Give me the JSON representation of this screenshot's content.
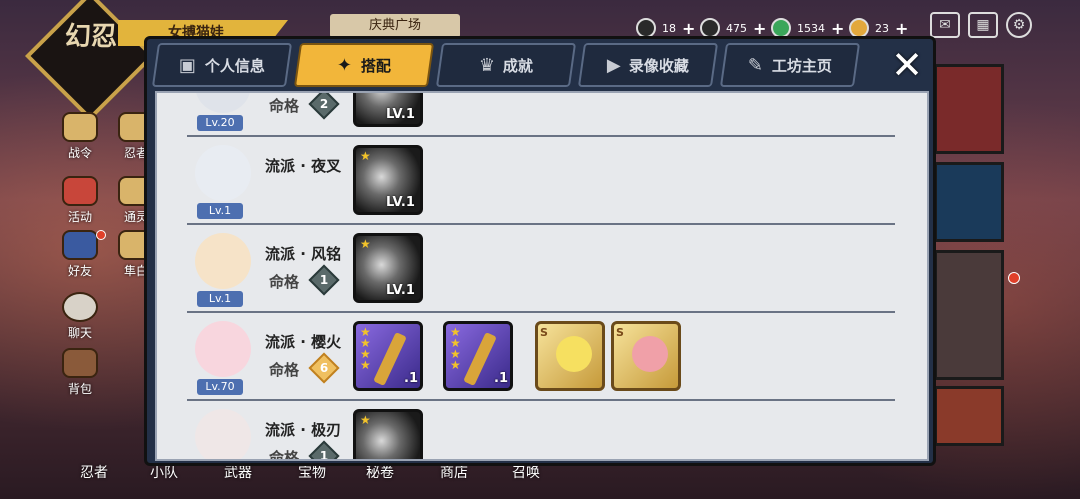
{
  "hud": {
    "logo_text": "幻忍",
    "player_name": "女搏猫娃",
    "plaza": "庆典广场",
    "resources": [
      {
        "icon": "onigiri-icon",
        "value": "18"
      },
      {
        "icon": "coin-icon",
        "value": "475"
      },
      {
        "icon": "jade-icon",
        "value": "1534"
      },
      {
        "icon": "token-icon",
        "value": "23"
      }
    ],
    "icons": [
      "mail-icon",
      "shop-icon",
      "gear-icon"
    ]
  },
  "sidebar": [
    {
      "label": "战令",
      "icon": "battle-pass-icon"
    },
    {
      "label": "忍者",
      "icon": "ninja-icon"
    },
    {
      "label": "活动",
      "icon": "torii-icon"
    },
    {
      "label": "通灵",
      "icon": "summon-spirit-icon"
    },
    {
      "label": "好友",
      "icon": "friend-icon"
    },
    {
      "label": "隼白",
      "icon": "falcon-icon"
    },
    {
      "label": "聊天",
      "icon": "chat-icon"
    },
    {
      "label": "背包",
      "icon": "bag-icon"
    }
  ],
  "bottom_nav": [
    "忍者",
    "小队",
    "武器",
    "宝物",
    "秘卷",
    "商店",
    "召唤"
  ],
  "modal": {
    "tabs": [
      {
        "label": "个人信息",
        "icon": "profile-icon",
        "active": false
      },
      {
        "label": "搭配",
        "icon": "shuriken-icon",
        "active": true
      },
      {
        "label": "成就",
        "icon": "trophy-icon",
        "active": false
      },
      {
        "label": "录像收藏",
        "icon": "play-icon",
        "active": false
      },
      {
        "label": "工坊主页",
        "icon": "pen-icon",
        "active": false
      }
    ],
    "close": "✕",
    "fate_label": "命格",
    "rows": [
      {
        "level": "Lv.20",
        "school": "",
        "fate": "2",
        "items": [
          {
            "type": "weapon",
            "stars": 1,
            "lv": "LV.1"
          }
        ]
      },
      {
        "level": "Lv.1",
        "school": "流派 · 夜叉",
        "fate": "",
        "items": [
          {
            "type": "weapon",
            "stars": 1,
            "lv": "LV.1"
          }
        ]
      },
      {
        "level": "Lv.1",
        "school": "流派 · 风铭",
        "fate": "1",
        "items": [
          {
            "type": "weapon",
            "stars": 1,
            "lv": "LV.1"
          }
        ]
      },
      {
        "level": "Lv.70",
        "school": "流派 · 樱火",
        "fate": "6",
        "items": [
          {
            "type": "purple",
            "stars": 4,
            "lv": ".1"
          },
          {
            "type": "purple",
            "stars": 4,
            "lv": ".1"
          },
          {
            "type": "gold",
            "badge": "S"
          },
          {
            "type": "gold",
            "badge": "S"
          }
        ]
      },
      {
        "level": "",
        "school": "流派 · 极刃",
        "fate": "1",
        "items": [
          {
            "type": "weapon",
            "stars": 1,
            "lv": ""
          }
        ]
      }
    ]
  }
}
